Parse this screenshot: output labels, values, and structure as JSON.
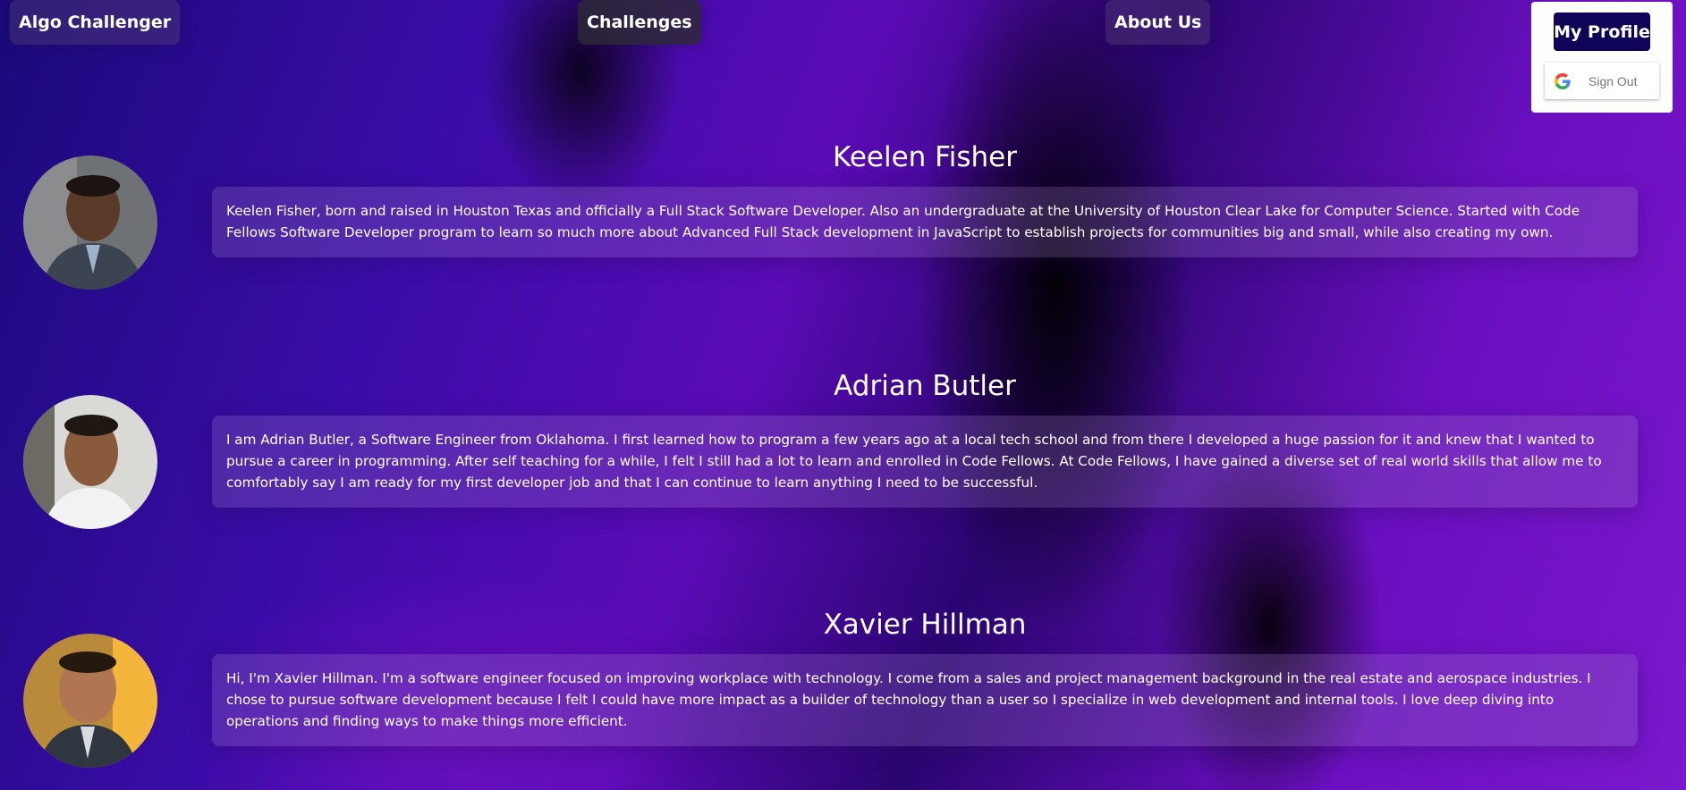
{
  "nav": {
    "brand": "Algo Challenger",
    "challenges": "Challenges",
    "about": "About Us"
  },
  "profile": {
    "my_profile": "My Profile",
    "sign_out": "Sign Out",
    "sign_out_icon": "google-g-icon"
  },
  "members": [
    {
      "name": "Keelen Fisher",
      "bio": "Keelen Fisher, born and raised in Houston Texas and officially a Full Stack Software Developer. Also an undergraduate at the University of Houston Clear Lake for Computer Science. Started with Code Fellows Software Developer program to learn so much more about Advanced Full Stack development in JavaScript to establish projects for communities big and small, while also creating my own."
    },
    {
      "name": "Adrian Butler",
      "bio": "I am Adrian Butler, a Software Engineer from Oklahoma. I first learned how to program a few years ago at a local tech school and from there I developed a huge passion for it and knew that I wanted to pursue a career in programming. After self teaching for a while, I felt I still had a lot to learn and enrolled in Code Fellows. At Code Fellows, I have gained a diverse set of real world skills that allow me to comfortably say I am ready for my first developer job and that I can continue to learn anything I need to be successful."
    },
    {
      "name": "Xavier Hillman",
      "bio": "Hi, I'm Xavier Hillman. I'm a software engineer focused on improving workplace with technology. I come from a sales and project management background in the real estate and aerospace industries. I chose to pursue software development because I felt I could have more impact as a builder of technology than a user so I specialize in web development and internal tools. I love deep diving into operations and finding ways to make things more efficient."
    }
  ],
  "colors": {
    "profile_button_bg": "#0e0559",
    "background_primary": "#5a0bb5"
  }
}
